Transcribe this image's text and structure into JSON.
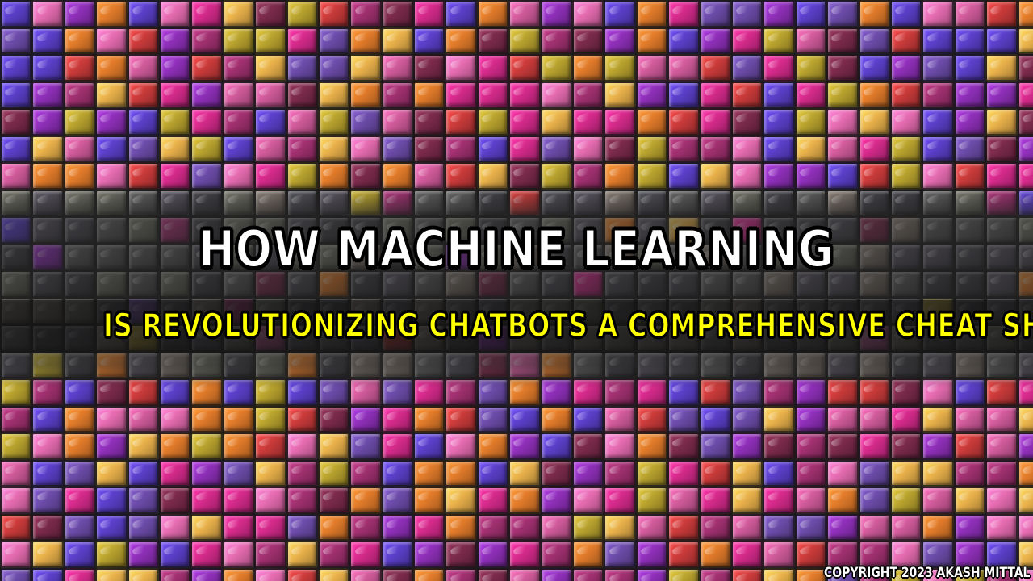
{
  "thumbnail": {
    "title_line_1": "HOW MACHINE LEARNING",
    "title_line_2": "IS REVOLUTIONIZING CHATBOTS A COMPREHENSIVE CHEAT SHEET",
    "copyright": "COPYRIGHT 2023 AKASH MITTAL"
  },
  "background": {
    "description_icon": "mosaic-tile-background",
    "palette": [
      "#d42a8a",
      "#8e2fb8",
      "#e07a2a",
      "#c93a3a",
      "#b8a22e",
      "#5a3fc8",
      "#e56bb0",
      "#7a2a4a",
      "#cf5a9a",
      "#a03070",
      "#e8b04a",
      "#6b4ba8"
    ],
    "muted_palette": [
      "#5a5a5a",
      "#4a4a52",
      "#6a6a60",
      "#3e3e44",
      "#7a7068",
      "#54505a"
    ],
    "title_color": "#ffffff",
    "subtitle_color": "#ffff00"
  }
}
